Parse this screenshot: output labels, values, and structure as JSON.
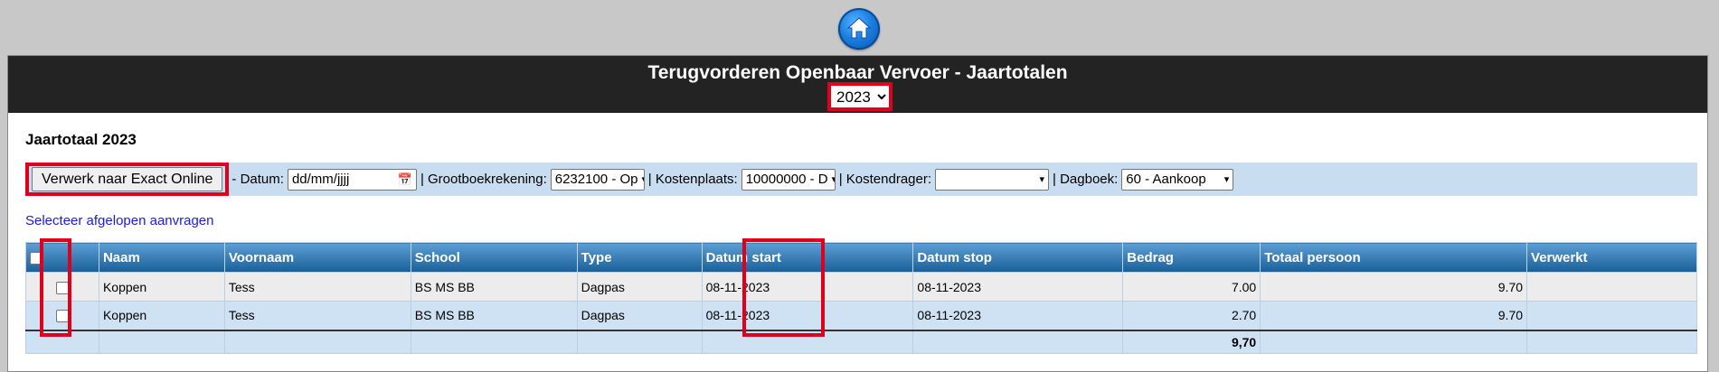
{
  "home": {
    "icon": "home-icon"
  },
  "header": {
    "title": "Terugvorderen Openbaar Vervoer - Jaartotalen",
    "year_selected": "2023"
  },
  "section_title": "Jaartotaal 2023",
  "toolbar": {
    "exact_button": "Verwerk naar Exact Online",
    "datum_label": "- Datum:",
    "datum_placeholder": "dd/mm/jjjj",
    "grootboek_label": "| Grootboekrekening:",
    "grootboek_value": "6232100 - Op",
    "kostenplaats_label": "| Kostenplaats:",
    "kostenplaats_value": "10000000 - D",
    "kostendrager_label": "| Kostendrager:",
    "kostendrager_value": "",
    "dagboek_label": "| Dagboek:",
    "dagboek_value": "60 - Aankoop"
  },
  "select_link": "Selecteer afgelopen aanvragen",
  "table": {
    "headers": [
      "",
      "Naam",
      "Voornaam",
      "School",
      "Type",
      "Datum start",
      "Datum stop",
      "Bedrag",
      "Totaal persoon",
      "Verwerkt"
    ],
    "rows": [
      {
        "naam": "Koppen",
        "voornaam": "Tess",
        "school": "BS MS BB",
        "type": "Dagpas",
        "start": "08-11-2023",
        "stop": "08-11-2023",
        "bedrag": "7.00",
        "totaal": "9.70",
        "verwerkt": ""
      },
      {
        "naam": "Koppen",
        "voornaam": "Tess",
        "school": "BS MS BB",
        "type": "Dagpas",
        "start": "08-11-2023",
        "stop": "08-11-2023",
        "bedrag": "2.70",
        "totaal": "9.70",
        "verwerkt": ""
      }
    ],
    "total": "9,70"
  },
  "colors": {
    "header_bg": "#232323",
    "highlight": "#e0001b",
    "table_header": "#1a5f98",
    "row_alt": "#cfe2f4",
    "green_date": "#1f8a1f"
  }
}
